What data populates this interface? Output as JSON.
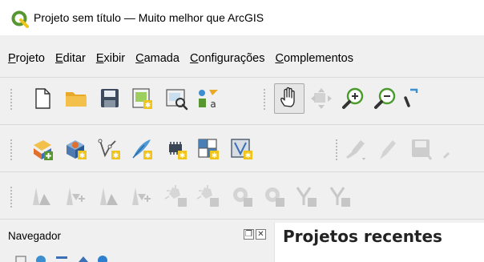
{
  "window": {
    "title": "Projeto sem título — Muito melhor que ArcGIS",
    "logo_icon": "qgis-logo-icon"
  },
  "menubar": {
    "items": [
      {
        "underline": "P",
        "rest": "rojeto"
      },
      {
        "underline": "E",
        "rest": "ditar"
      },
      {
        "underline": "E",
        "rest": "xibir"
      },
      {
        "underline": "C",
        "rest": "amada"
      },
      {
        "underline": "C",
        "rest": "onfigurações"
      },
      {
        "underline": "C",
        "rest": "omplementos"
      }
    ]
  },
  "toolbars": {
    "project": [
      "new-project-icon",
      "open-project-icon",
      "save-project-icon",
      "new-print-layout-icon",
      "layout-manager-icon",
      "style-manager-icon"
    ],
    "navigation": [
      "pan-map-icon",
      "pan-to-selection-icon",
      "zoom-in-icon",
      "zoom-out-icon",
      "zoom-full-icon"
    ],
    "data_source": [
      "data-source-manager-icon",
      "new-geopackage-layer-icon",
      "new-shapefile-layer-icon",
      "new-spatialite-layer-icon",
      "new-temporary-scratch-layer-icon",
      "new-virtual-layer-icon",
      "new-mesh-layer-icon"
    ],
    "digitizing": [
      "toggle-editing-icon",
      "current-edits-icon",
      "save-edits-icon",
      "edit-more-icon"
    ],
    "advanced": [
      "vertex-tool-icon",
      "vertex-tool-all-icon",
      "select-vertex-icon",
      "select-vertex-all-icon",
      "add-ring-icon",
      "add-part-icon",
      "fill-ring-icon",
      "delete-ring-icon",
      "reshape-icon",
      "offset-curve-icon"
    ]
  },
  "panel": {
    "title": "Navegador",
    "float_icon": "float-panel-icon",
    "close_icon": "close-panel-icon"
  },
  "main": {
    "heading": "Projetos recentes"
  },
  "colors": {
    "qgis_green": "#589632",
    "qgis_yellow": "#f0c419",
    "folder_yellow": "#f3c14b",
    "disabled_gray": "#c8c8c8",
    "magnifier_green": "#4b9a2e"
  }
}
